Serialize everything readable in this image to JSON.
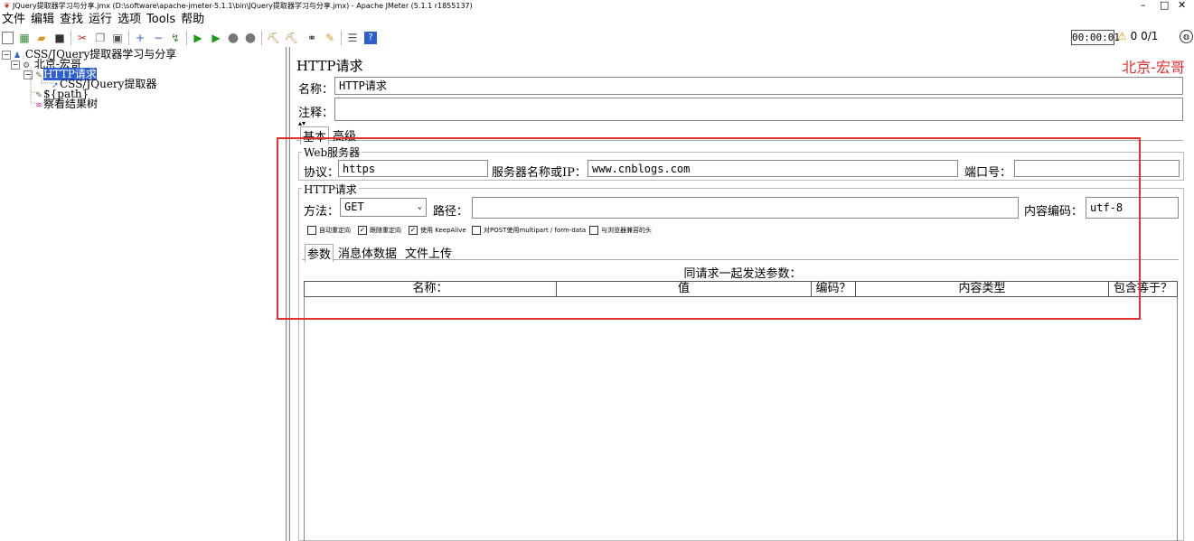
{
  "window": {
    "title": "JQuery提取器学习与分享.jmx (D:\\software\\apache-jmeter-5.1.1\\bin\\JQuery提取器学习与分享.jmx) - Apache JMeter (5.1.1 r1855137)",
    "minimize": "–",
    "maximize": "□",
    "close": "✕"
  },
  "menu": [
    "文件",
    "编辑",
    "查找",
    "运行",
    "选项",
    "Tools",
    "帮助"
  ],
  "status": {
    "timer": "00:00:01",
    "warnings": "0",
    "threads": "0/1"
  },
  "tree": {
    "items": [
      {
        "label": "CSS/JQuery提取器学习与分享"
      },
      {
        "label": "北京-宏哥"
      },
      {
        "label": "HTTP请求"
      },
      {
        "label": "CSS/JQuery提取器"
      },
      {
        "label": "${path}"
      },
      {
        "label": "察看结果树"
      }
    ]
  },
  "panel": {
    "title": "HTTP请求",
    "brand": "北京-宏哥",
    "name_label": "名称：",
    "name_value": "HTTP请求",
    "comment_label": "注释：",
    "comment_value": "",
    "tabs": [
      "基本",
      "高级"
    ]
  },
  "web_server": {
    "legend": "Web服务器",
    "protocol_label": "协议：",
    "protocol_value": "https",
    "server_label": "服务器名称或IP：",
    "server_value": "www.cnblogs.com",
    "port_label": "端口号：",
    "port_value": ""
  },
  "http_request": {
    "legend": "HTTP请求",
    "method_label": "方法：",
    "method_value": "GET",
    "path_label": "路径：",
    "path_value": "",
    "encoding_label": "内容编码：",
    "encoding_value": "utf-8",
    "options": [
      {
        "label": "自动重定向",
        "checked": false
      },
      {
        "label": "跟随重定向",
        "checked": true
      },
      {
        "label": "使用 KeepAlive",
        "checked": true
      },
      {
        "label": "对POST使用multipart / form-data",
        "checked": false
      },
      {
        "label": "与浏览器兼容的头",
        "checked": false
      }
    ],
    "subtabs": [
      "参数",
      "消息体数据",
      "文件上传"
    ]
  },
  "params": {
    "caption": "同请求一起发送参数：",
    "columns": [
      "名称：",
      "值",
      "编码？",
      "内容类型",
      "包含等于？"
    ]
  }
}
